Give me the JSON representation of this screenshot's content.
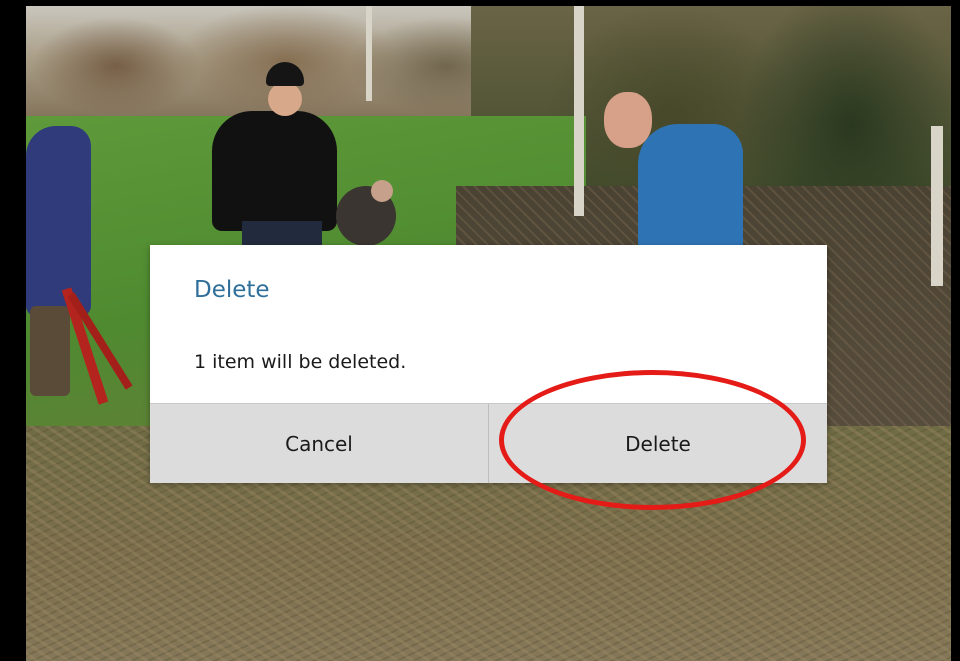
{
  "dialog": {
    "title": "Delete",
    "message": "1 item will be deleted.",
    "cancel_label": "Cancel",
    "delete_label": "Delete"
  },
  "colors": {
    "title_accent": "#2f6f9a",
    "button_bg": "#dcdcdc",
    "annotation": "#e41b17",
    "frame": "#000000"
  }
}
